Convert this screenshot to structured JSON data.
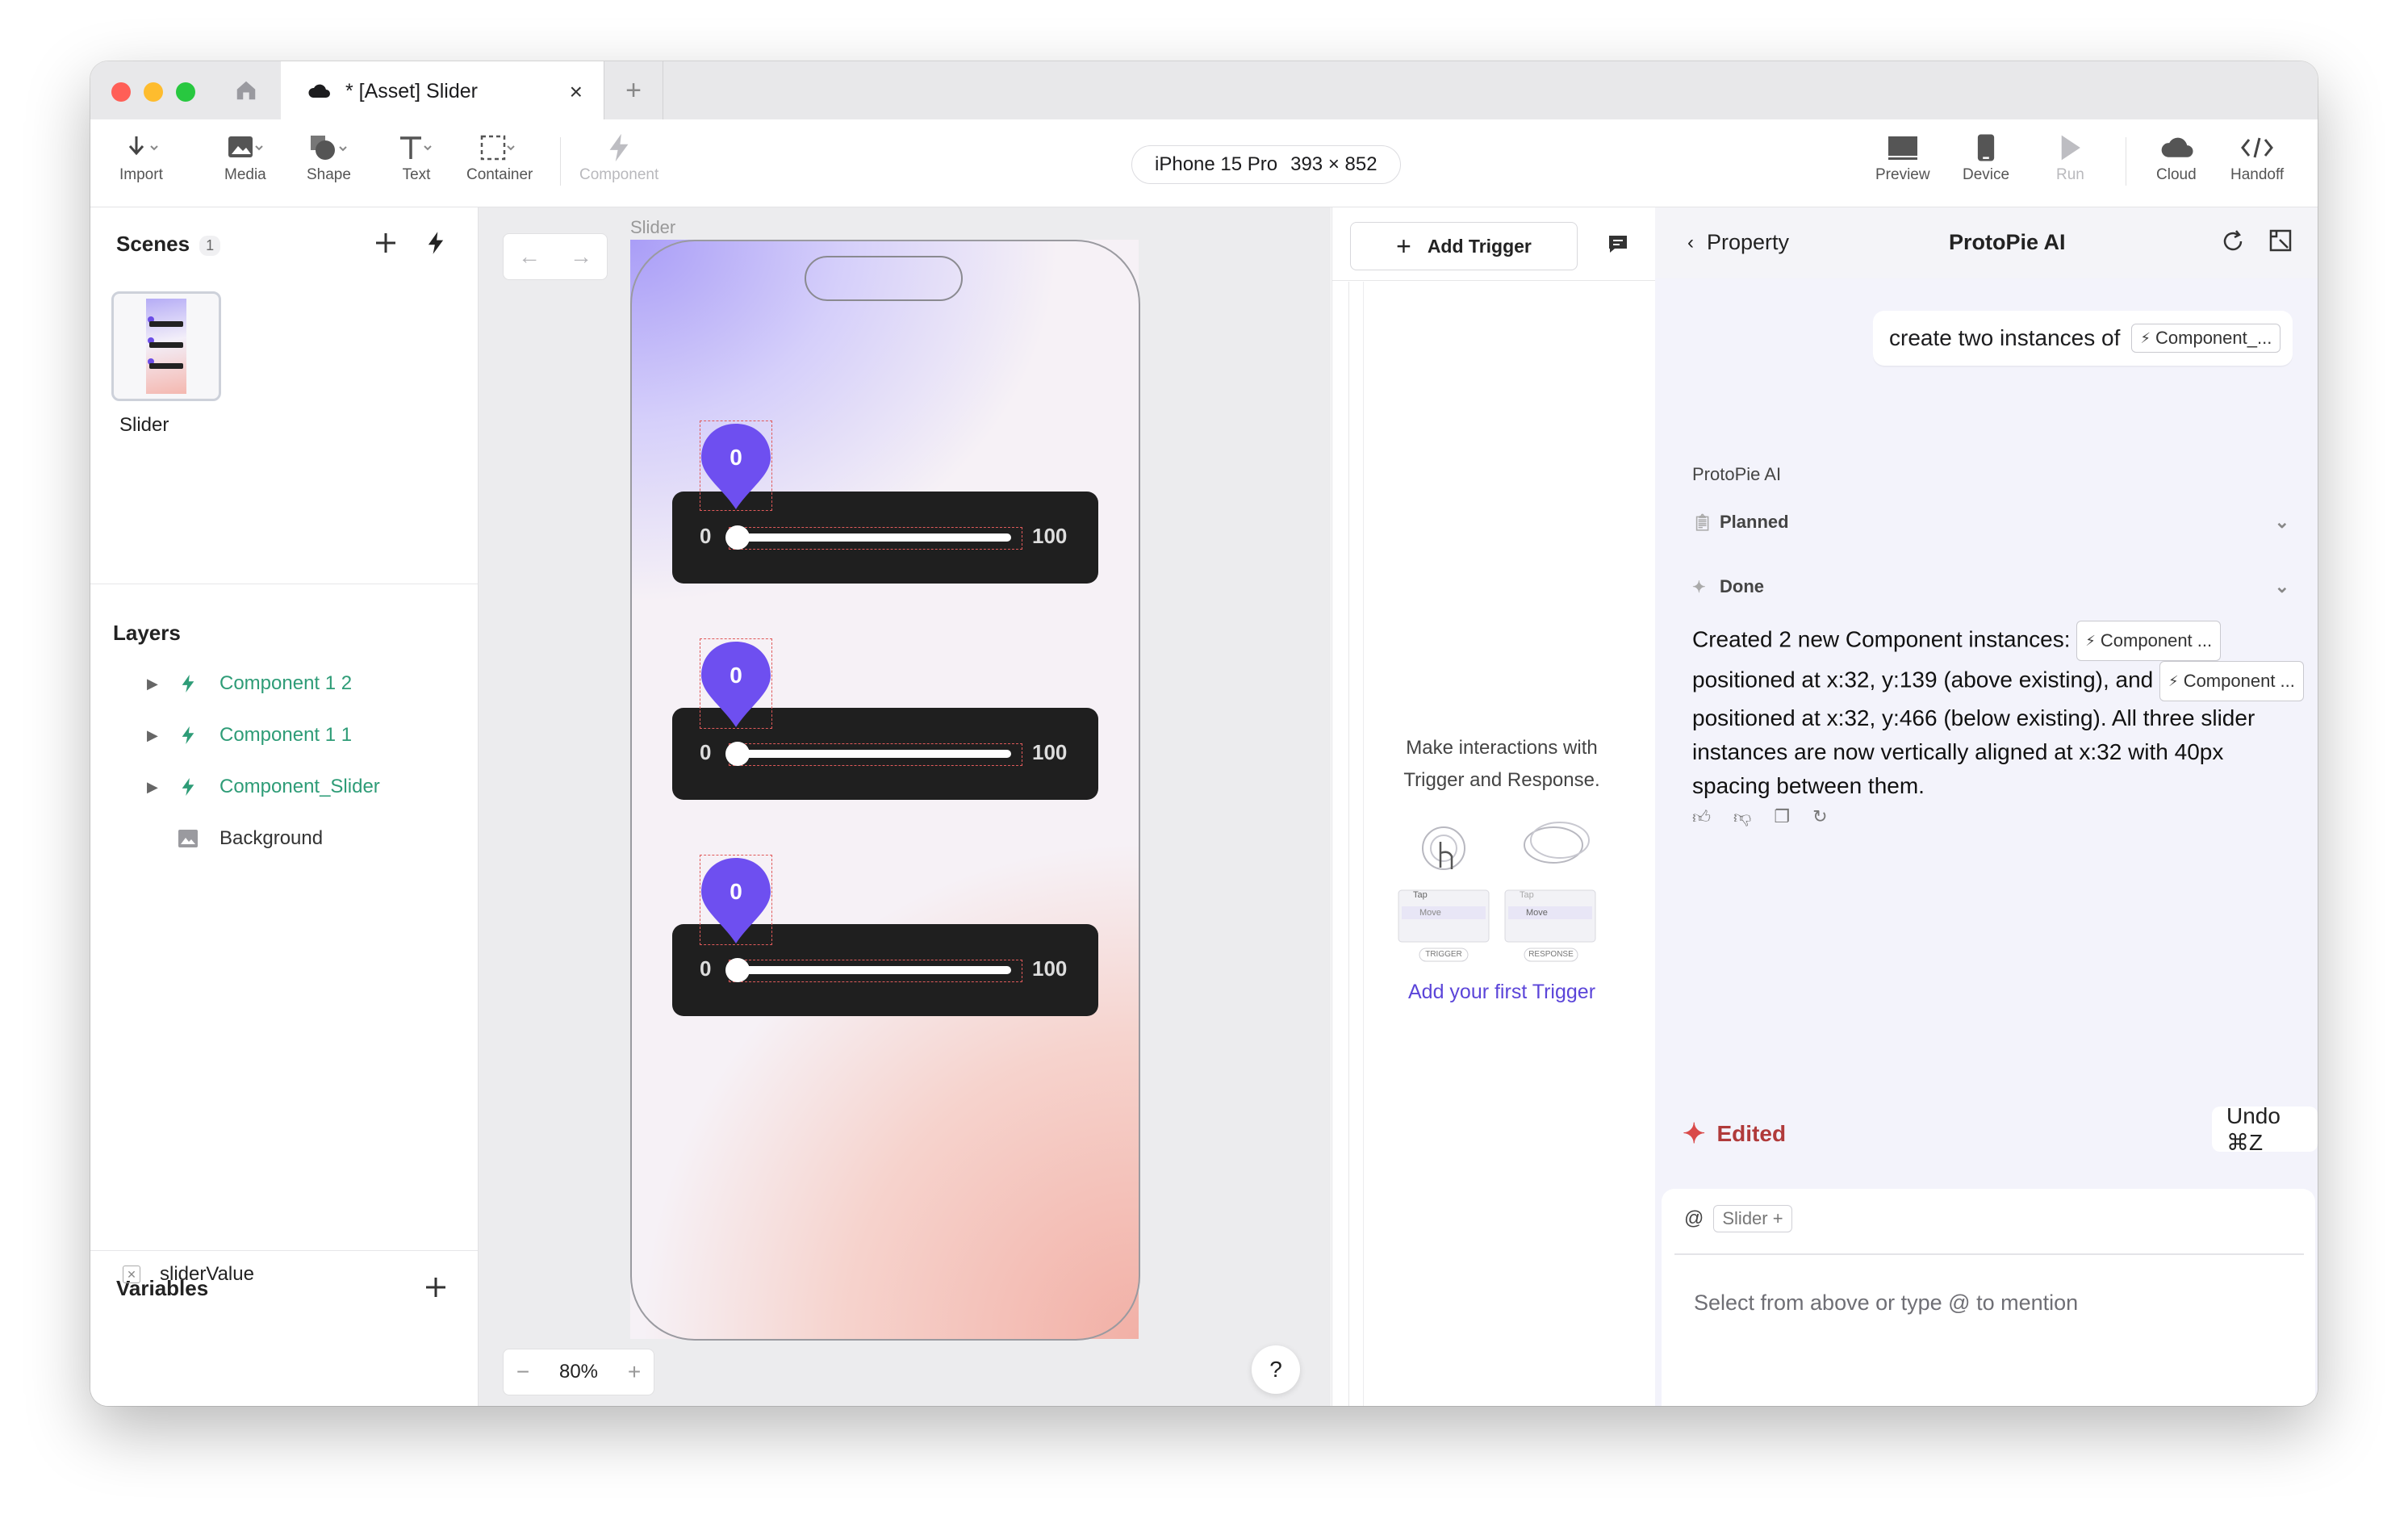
{
  "window": {
    "tab_title": "* [Asset] Slider",
    "traffic_lights": [
      "#ff5f57",
      "#febc2e",
      "#28c840"
    ]
  },
  "toolbar": {
    "left_tools": [
      {
        "label": "Import",
        "icon": "import-icon"
      },
      {
        "label": "Media",
        "icon": "media-icon"
      },
      {
        "label": "Shape",
        "icon": "shape-icon"
      },
      {
        "label": "Text",
        "icon": "text-icon"
      },
      {
        "label": "Container",
        "icon": "container-icon"
      },
      {
        "label": "Component",
        "icon": "component-icon",
        "disabled": true
      }
    ],
    "device": {
      "name": "iPhone 15 Pro",
      "dims": "393 × 852"
    },
    "right_tools": [
      {
        "label": "Preview",
        "icon": "preview-icon"
      },
      {
        "label": "Device",
        "icon": "device-icon"
      },
      {
        "label": "Run",
        "icon": "run-icon",
        "disabled": true
      },
      {
        "label": "Cloud",
        "icon": "cloud-icon"
      },
      {
        "label": "Handoff",
        "icon": "handoff-icon"
      }
    ]
  },
  "scenes": {
    "title": "Scenes",
    "count": "1",
    "items": [
      {
        "label": "Slider"
      }
    ]
  },
  "layers": {
    "title": "Layers",
    "items": [
      {
        "label": "Component 1 2",
        "kind": "component"
      },
      {
        "label": "Component 1 1",
        "kind": "component"
      },
      {
        "label": "Component_Slider",
        "kind": "component"
      },
      {
        "label": "Background",
        "kind": "image"
      }
    ]
  },
  "variables": {
    "title": "Variables",
    "items": [
      {
        "label": "sliderValue"
      }
    ]
  },
  "canvas": {
    "frame_label": "Slider",
    "zoom": "80%",
    "help": "?",
    "sliders": [
      {
        "value": "0",
        "min": "0",
        "max": "100"
      },
      {
        "value": "0",
        "min": "0",
        "max": "100"
      },
      {
        "value": "0",
        "min": "0",
        "max": "100"
      }
    ]
  },
  "interaction": {
    "add_trigger": "Add Trigger",
    "message_line1": "Make interactions with",
    "message_line2": "Trigger and Response.",
    "illus_trigger_tag": "TRIGGER",
    "illus_response_tag": "RESPONSE",
    "illus_tap": "Tap",
    "illus_move": "Move",
    "first_trigger": "Add your first Trigger"
  },
  "ai": {
    "back_label": "Property",
    "title": "ProtoPie AI",
    "user_message": "create two instances of",
    "user_chip": "Component_...",
    "assistant_name": "ProtoPie AI",
    "steps": [
      {
        "label": "Planned"
      },
      {
        "label": "Done"
      }
    ],
    "response": {
      "p1": "Created 2 new Component instances:",
      "chip1": "Component ...",
      "p2": "positioned at x:32, y:139 (above existing), and",
      "chip2": "Component ...",
      "p3": "positioned at x:32, y:466 (below existing). All three slider instances are now vertically aligned at x:32 with 40px spacing between them."
    },
    "edited_label": "Edited",
    "undo_label": "Undo ⌘Z",
    "mention_at": "@",
    "mention_chip": "Slider +",
    "input_placeholder": "Select from above or type @ to mention",
    "more": "..."
  }
}
